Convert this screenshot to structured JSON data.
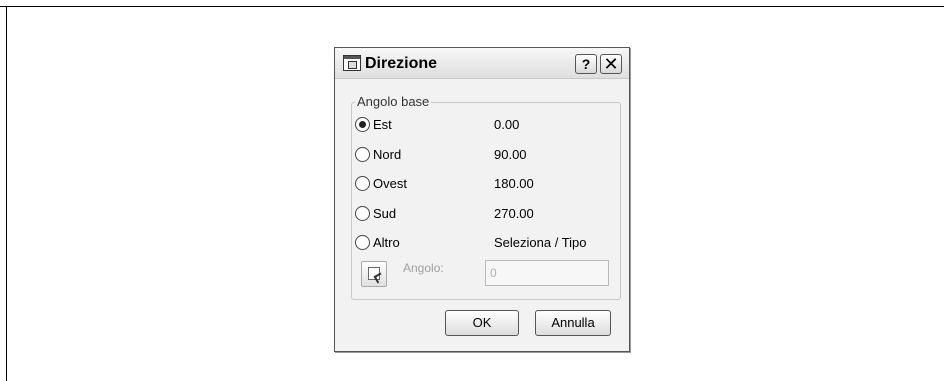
{
  "dialog": {
    "title": "Direzione",
    "help_button": "?",
    "close_button": "✕",
    "group_label": "Angolo base",
    "options": [
      {
        "label": "Est",
        "value": "0.00",
        "checked": true
      },
      {
        "label": "Nord",
        "value": "90.00",
        "checked": false
      },
      {
        "label": "Ovest",
        "value": "180.00",
        "checked": false
      },
      {
        "label": "Sud",
        "value": "270.00",
        "checked": false
      },
      {
        "label": "Altro",
        "value": "Seleziona / Tipo",
        "checked": false
      }
    ],
    "angle_label": "Angolo:",
    "angle_value": "0",
    "ok_label": "OK",
    "cancel_label": "Annulla"
  }
}
